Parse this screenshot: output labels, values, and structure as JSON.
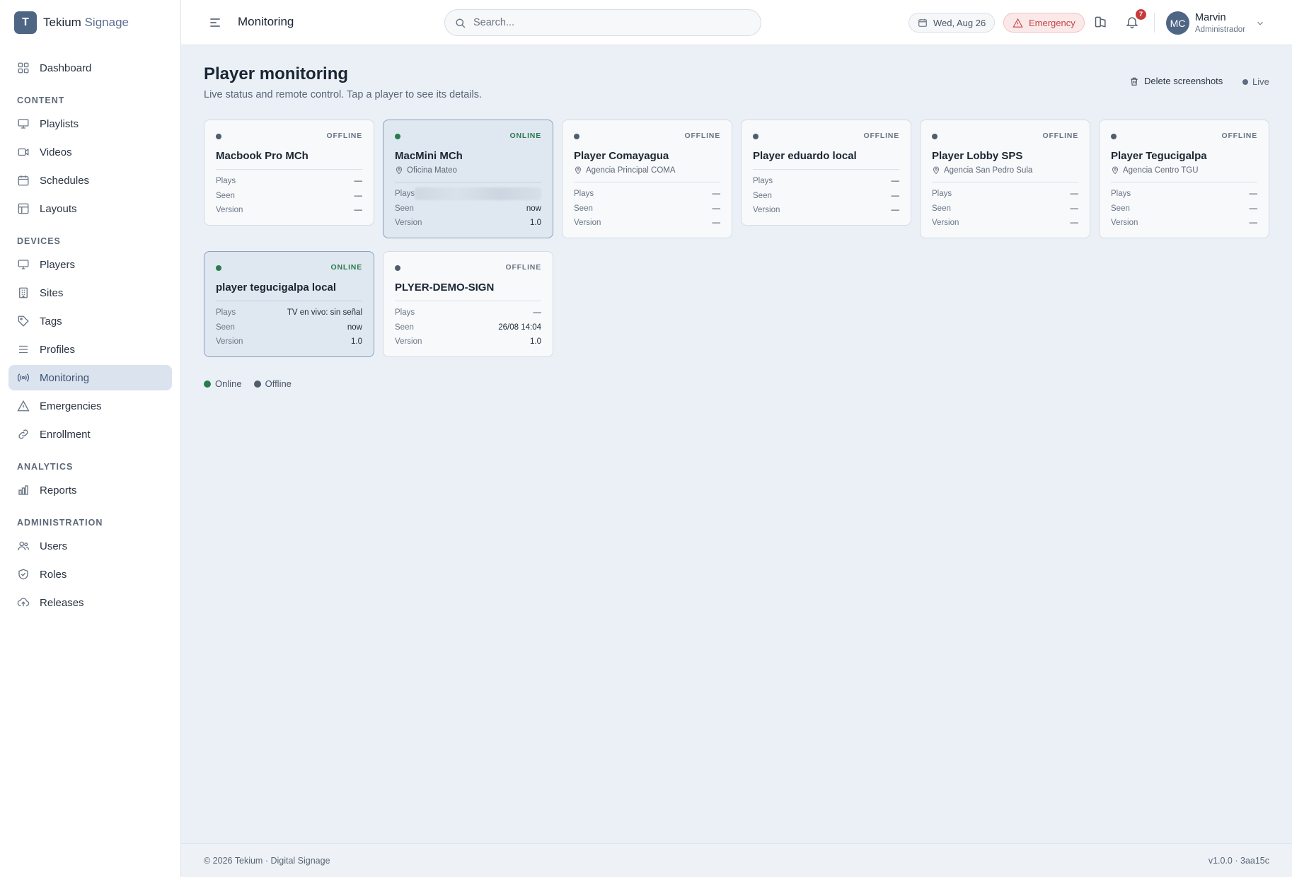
{
  "brand": {
    "logo_letter": "T",
    "name_main": "Tekium",
    "name_accent": "Signage"
  },
  "sidebar": {
    "dashboard": "Dashboard",
    "section_content": "CONTENT",
    "playlists": "Playlists",
    "videos": "Videos",
    "schedules": "Schedules",
    "layouts": "Layouts",
    "section_devices": "DEVICES",
    "players": "Players",
    "sites": "Sites",
    "tags": "Tags",
    "profiles": "Profiles",
    "monitoring": "Monitoring",
    "emergencies": "Emergencies",
    "enrollment": "Enrollment",
    "section_analytics": "ANALYTICS",
    "reports": "Reports",
    "section_administration": "ADMINISTRATION",
    "users": "Users",
    "roles": "Roles",
    "releases": "Releases",
    "active": "monitoring"
  },
  "header": {
    "title": "Monitoring",
    "search_placeholder": "Search...",
    "date": "Wed, Aug 26",
    "emergency": "Emergency",
    "notification_count": "7",
    "user_initials": "MC",
    "user_name": "Marvin",
    "user_role": "Administrador"
  },
  "main": {
    "title": "Player monitoring",
    "subtitle": "Live status and remote control. Tap a player to see its details.",
    "delete_screenshots": "Delete screenshots",
    "live": "Live",
    "labels": {
      "plays": "Plays",
      "seen": "Seen",
      "version": "Version"
    },
    "players": [
      {
        "name": "Macbook Pro MCh",
        "status": "OFFLINE",
        "location": "",
        "plays": "—",
        "seen": "—",
        "version": "—"
      },
      {
        "name": "MacMini MCh",
        "status": "ONLINE",
        "location": "Oficina Mateo",
        "plays": "",
        "seen": "now",
        "version": "1.0"
      },
      {
        "name": "Player Comayagua",
        "status": "OFFLINE",
        "location": "Agencia Principal COMA",
        "plays": "—",
        "seen": "—",
        "version": "—"
      },
      {
        "name": "Player eduardo local",
        "status": "OFFLINE",
        "location": "",
        "plays": "—",
        "seen": "—",
        "version": "—"
      },
      {
        "name": "Player Lobby SPS",
        "status": "OFFLINE",
        "location": "Agencia San Pedro Sula",
        "plays": "—",
        "seen": "—",
        "version": "—"
      },
      {
        "name": "Player Tegucigalpa",
        "status": "OFFLINE",
        "location": "Agencia Centro TGU",
        "plays": "—",
        "seen": "—",
        "version": "—"
      },
      {
        "name": "player tegucigalpa local",
        "status": "ONLINE",
        "location": "",
        "plays": "TV en vivo: sin señal",
        "seen": "now",
        "version": "1.0"
      },
      {
        "name": "PLYER-DEMO-SIGN",
        "status": "OFFLINE",
        "location": "",
        "plays": "—",
        "seen": "26/08 14:04",
        "version": "1.0"
      }
    ],
    "legend": {
      "online": "Online",
      "offline": "Offline"
    }
  },
  "colors": {
    "accent": "#4e6584",
    "online": "#2a7a4f",
    "offline": "#4f5d6d",
    "emergency": "#c24444"
  },
  "footer": {
    "left": "© 2026 Tekium · Digital Signage",
    "right": "v1.0.0 · 3aa15c"
  }
}
